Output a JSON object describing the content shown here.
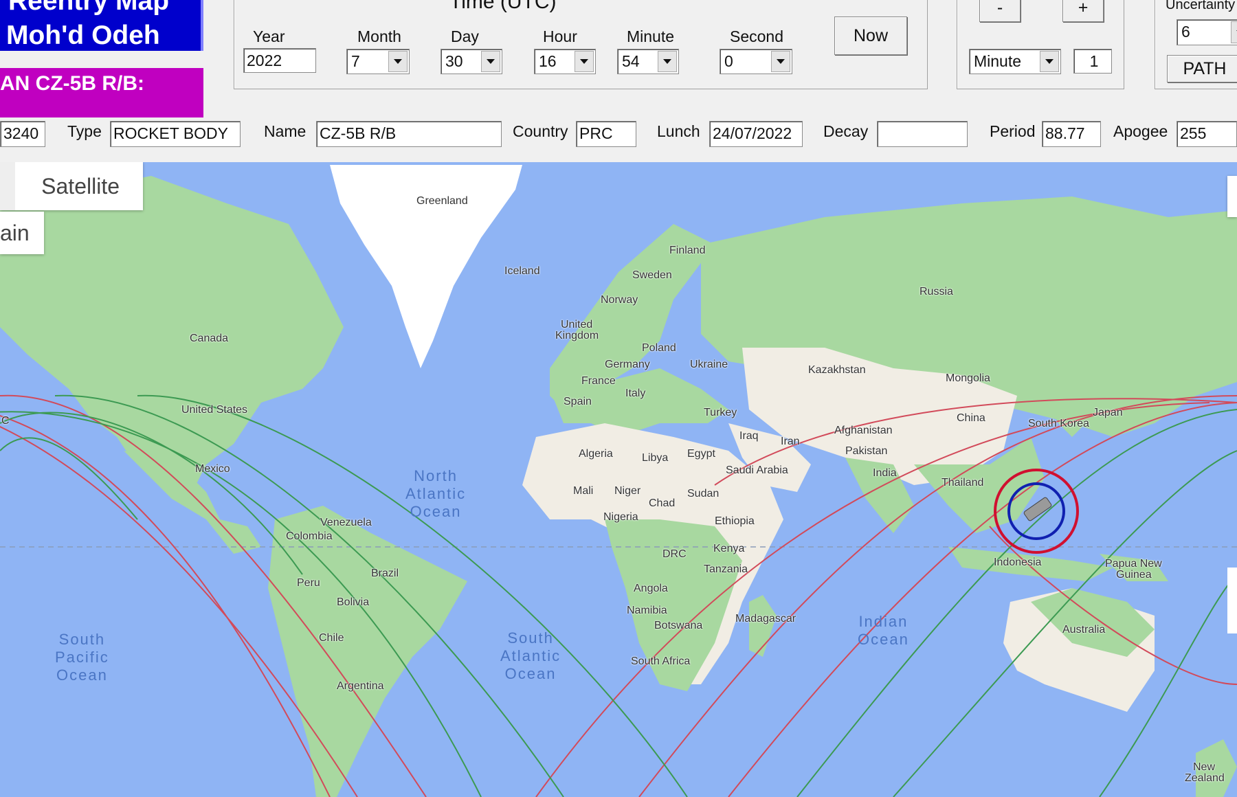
{
  "header": {
    "title_line1": "Reentry Map",
    "title_line2": "Moh'd Odeh",
    "object_label": "AN CZ-5B R/B:"
  },
  "time": {
    "title": "Time (UTC)",
    "year_label": "Year",
    "year_value": "2022",
    "month_label": "Month",
    "month_value": "7",
    "day_label": "Day",
    "day_value": "30",
    "hour_label": "Hour",
    "hour_value": "16",
    "minute_label": "Minute",
    "minute_value": "54",
    "second_label": "Second",
    "second_value": "0",
    "now_label": "Now"
  },
  "step": {
    "minus_label": "-",
    "plus_label": "+",
    "unit_value": "Minute",
    "amount_value": "1"
  },
  "uncertainty": {
    "label": "Uncertainty",
    "value": "6",
    "path_label": "PATH"
  },
  "info": {
    "id_value": "3240",
    "type_label": "Type",
    "type_value": "ROCKET BODY",
    "name_label": "Name",
    "name_value": "CZ-5B R/B",
    "country_label": "Country",
    "country_value": "PRC",
    "launch_label": "Lunch",
    "launch_value": "24/07/2022",
    "decay_label": "Decay",
    "decay_value": "",
    "period_label": "Period",
    "period_value": "88.77",
    "apogee_label": "Apogee",
    "apogee_value": "255"
  },
  "map": {
    "satellite_button": "Satellite",
    "terrain_button": "ain",
    "oceans": {
      "north_atlantic": [
        "North",
        "Atlantic",
        "Ocean"
      ],
      "south_atlantic": [
        "South",
        "Atlantic",
        "Ocean"
      ],
      "south_pacific": [
        "South",
        "Pacific",
        "Ocean"
      ],
      "indian": [
        "Indian",
        "Ocean"
      ]
    },
    "labels": {
      "greenland": "Greenland",
      "iceland": "Iceland",
      "finland": "Finland",
      "sweden": "Sweden",
      "norway": "Norway",
      "united": "United",
      "kingdom": "Kingdom",
      "poland": "Poland",
      "germany": "Germany",
      "ukraine": "Ukraine",
      "france": "France",
      "italy": "Italy",
      "spain": "Spain",
      "turkey": "Turkey",
      "russia": "Russia",
      "kazakhstan": "Kazakhstan",
      "mongolia": "Mongolia",
      "china": "China",
      "south_korea": "South Korea",
      "japan": "Japan",
      "iraq": "Iraq",
      "iran": "Iran",
      "afghanistan": "Afghanistan",
      "pakistan": "Pakistan",
      "india": "India",
      "thailand": "Thailand",
      "saudi_arabia": "Saudi Arabia",
      "egypt": "Egypt",
      "libya": "Libya",
      "algeria": "Algeria",
      "mali": "Mali",
      "niger": "Niger",
      "chad": "Chad",
      "sudan": "Sudan",
      "nigeria": "Nigeria",
      "ethiopia": "Ethiopia",
      "kenya": "Kenya",
      "drc": "DRC",
      "tanzania": "Tanzania",
      "angola": "Angola",
      "namibia": "Namibia",
      "botswana": "Botswana",
      "south_africa": "South Africa",
      "madagascar": "Madagascar",
      "indonesia": "Indonesia",
      "papua": "Papua New",
      "guinea": "Guinea",
      "australia": "Australia",
      "new_zealand_1": "New",
      "new_zealand_2": "Zealand",
      "canada": "Canada",
      "united_states": "United States",
      "mexico": "Mexico",
      "venezuela": "Venezuela",
      "colombia": "Colombia",
      "brazil": "Brazil",
      "peru": "Peru",
      "bolivia": "Bolivia",
      "chile": "Chile",
      "argentina": "Argentina",
      "c": "C"
    },
    "colors": {
      "ocean": "#8fb4f4",
      "land": "#a8d8a0",
      "desert": "#f1ede4",
      "ice": "#ffffff",
      "track_red": "#d24a5a",
      "track_green": "#3c9a52",
      "marker_red": "#d01030",
      "marker_blue": "#1020b0"
    }
  }
}
